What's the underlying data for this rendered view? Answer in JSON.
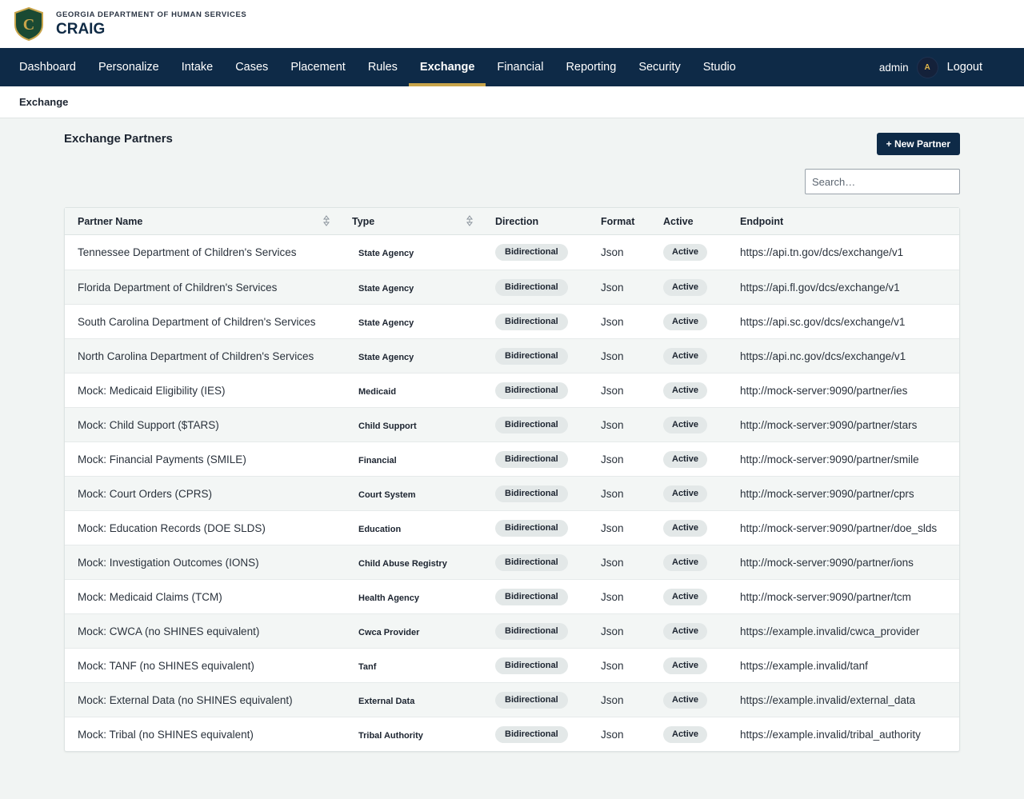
{
  "brand": {
    "org": "GEORGIA DEPARTMENT OF HUMAN SERVICES",
    "app": "CRAIG",
    "logo_letter": "C",
    "logo_color": "#1a4a33",
    "logo_accent": "#c8a44a"
  },
  "nav": {
    "items": [
      {
        "label": "Dashboard",
        "active": false
      },
      {
        "label": "Personalize",
        "active": false
      },
      {
        "label": "Intake",
        "active": false
      },
      {
        "label": "Cases",
        "active": false
      },
      {
        "label": "Placement",
        "active": false
      },
      {
        "label": "Rules",
        "active": false
      },
      {
        "label": "Exchange",
        "active": true
      },
      {
        "label": "Financial",
        "active": false
      },
      {
        "label": "Reporting",
        "active": false
      },
      {
        "label": "Security",
        "active": false
      },
      {
        "label": "Studio",
        "active": false
      }
    ],
    "user": "admin",
    "avatar_initial": "A",
    "logout": "Logout"
  },
  "breadcrumb": "Exchange",
  "page": {
    "title": "Exchange Partners",
    "new_button": "+ New Partner",
    "search_placeholder": "Search…"
  },
  "table": {
    "columns": [
      "Partner Name",
      "Type",
      "Direction",
      "Format",
      "Active",
      "Endpoint"
    ],
    "rows": [
      {
        "name": "Tennessee Department of Children's Services",
        "type": "State Agency",
        "direction": "Bidirectional",
        "format": "Json",
        "active": "Active",
        "endpoint": "https://api.tn.gov/dcs/exchange/v1"
      },
      {
        "name": "Florida Department of Children's Services",
        "type": "State Agency",
        "direction": "Bidirectional",
        "format": "Json",
        "active": "Active",
        "endpoint": "https://api.fl.gov/dcs/exchange/v1"
      },
      {
        "name": "South Carolina Department of Children's Services",
        "type": "State Agency",
        "direction": "Bidirectional",
        "format": "Json",
        "active": "Active",
        "endpoint": "https://api.sc.gov/dcs/exchange/v1"
      },
      {
        "name": "North Carolina Department of Children's Services",
        "type": "State Agency",
        "direction": "Bidirectional",
        "format": "Json",
        "active": "Active",
        "endpoint": "https://api.nc.gov/dcs/exchange/v1"
      },
      {
        "name": "Mock: Medicaid Eligibility (IES)",
        "type": "Medicaid",
        "direction": "Bidirectional",
        "format": "Json",
        "active": "Active",
        "endpoint": "http://mock-server:9090/partner/ies"
      },
      {
        "name": "Mock: Child Support ($TARS)",
        "type": "Child Support",
        "direction": "Bidirectional",
        "format": "Json",
        "active": "Active",
        "endpoint": "http://mock-server:9090/partner/stars"
      },
      {
        "name": "Mock: Financial Payments (SMILE)",
        "type": "Financial",
        "direction": "Bidirectional",
        "format": "Json",
        "active": "Active",
        "endpoint": "http://mock-server:9090/partner/smile"
      },
      {
        "name": "Mock: Court Orders (CPRS)",
        "type": "Court System",
        "direction": "Bidirectional",
        "format": "Json",
        "active": "Active",
        "endpoint": "http://mock-server:9090/partner/cprs"
      },
      {
        "name": "Mock: Education Records (DOE SLDS)",
        "type": "Education",
        "direction": "Bidirectional",
        "format": "Json",
        "active": "Active",
        "endpoint": "http://mock-server:9090/partner/doe_slds"
      },
      {
        "name": "Mock: Investigation Outcomes (IONS)",
        "type": "Child Abuse Registry",
        "direction": "Bidirectional",
        "format": "Json",
        "active": "Active",
        "endpoint": "http://mock-server:9090/partner/ions"
      },
      {
        "name": "Mock: Medicaid Claims (TCM)",
        "type": "Health Agency",
        "direction": "Bidirectional",
        "format": "Json",
        "active": "Active",
        "endpoint": "http://mock-server:9090/partner/tcm"
      },
      {
        "name": "Mock: CWCA (no SHINES equivalent)",
        "type": "Cwca Provider",
        "direction": "Bidirectional",
        "format": "Json",
        "active": "Active",
        "endpoint": "https://example.invalid/cwca_provider"
      },
      {
        "name": "Mock: TANF (no SHINES equivalent)",
        "type": "Tanf",
        "direction": "Bidirectional",
        "format": "Json",
        "active": "Active",
        "endpoint": "https://example.invalid/tanf"
      },
      {
        "name": "Mock: External Data (no SHINES equivalent)",
        "type": "External Data",
        "direction": "Bidirectional",
        "format": "Json",
        "active": "Active",
        "endpoint": "https://example.invalid/external_data"
      },
      {
        "name": "Mock: Tribal (no SHINES equivalent)",
        "type": "Tribal Authority",
        "direction": "Bidirectional",
        "format": "Json",
        "active": "Active",
        "endpoint": "https://example.invalid/tribal_authority"
      }
    ]
  },
  "icons": {
    "sort": "sort-icon",
    "logo": "shield-logo-icon"
  }
}
